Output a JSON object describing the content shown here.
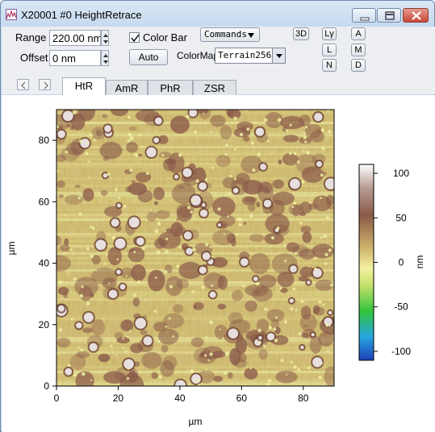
{
  "window": {
    "title": "X20001 #0 HeightRetrace",
    "controls": [
      "minimize-icon",
      "restore-icon",
      "close-icon"
    ]
  },
  "toolbar": {
    "range_label": "Range",
    "range_value": "220.00 nm",
    "offset_label": "Offset",
    "offset_value": "0 nm",
    "colorbar_label": "Color Bar",
    "colorbar_checked": true,
    "auto_button": "Auto",
    "commands_button": "Commands",
    "colormap_label": "ColorMap",
    "colormap_value": "Terrain256",
    "btn_3d": "3D",
    "btn_ly": "Lγ",
    "btn_l": "L",
    "btn_n": "N",
    "btn_a": "A",
    "btn_m": "M",
    "btn_d": "D"
  },
  "tabs": {
    "prev": "<",
    "next": ">",
    "items": [
      "HtR",
      "AmR",
      "PhR",
      "ZSR"
    ],
    "active": "HtR"
  },
  "chart_data": {
    "type": "heatmap",
    "title": "",
    "xlabel": "µm",
    "ylabel": "µm",
    "xlim": [
      0,
      90
    ],
    "ylim": [
      0,
      90
    ],
    "x_ticks": [
      "0",
      "20",
      "40",
      "60",
      "80"
    ],
    "y_ticks": [
      "0",
      "20",
      "40",
      "60",
      "80"
    ],
    "colorbar": {
      "label": "nm",
      "ticks": [
        "100",
        "50",
        "0",
        "-50",
        "-100"
      ],
      "range": [
        -110,
        110
      ],
      "colormap": "Terrain256"
    },
    "colors": {
      "background": "#cbb56a",
      "flat": "#d9cf7a",
      "bright": "#eef0a3",
      "feature": "#8a5a4a",
      "peak": "#f2ecef"
    }
  }
}
